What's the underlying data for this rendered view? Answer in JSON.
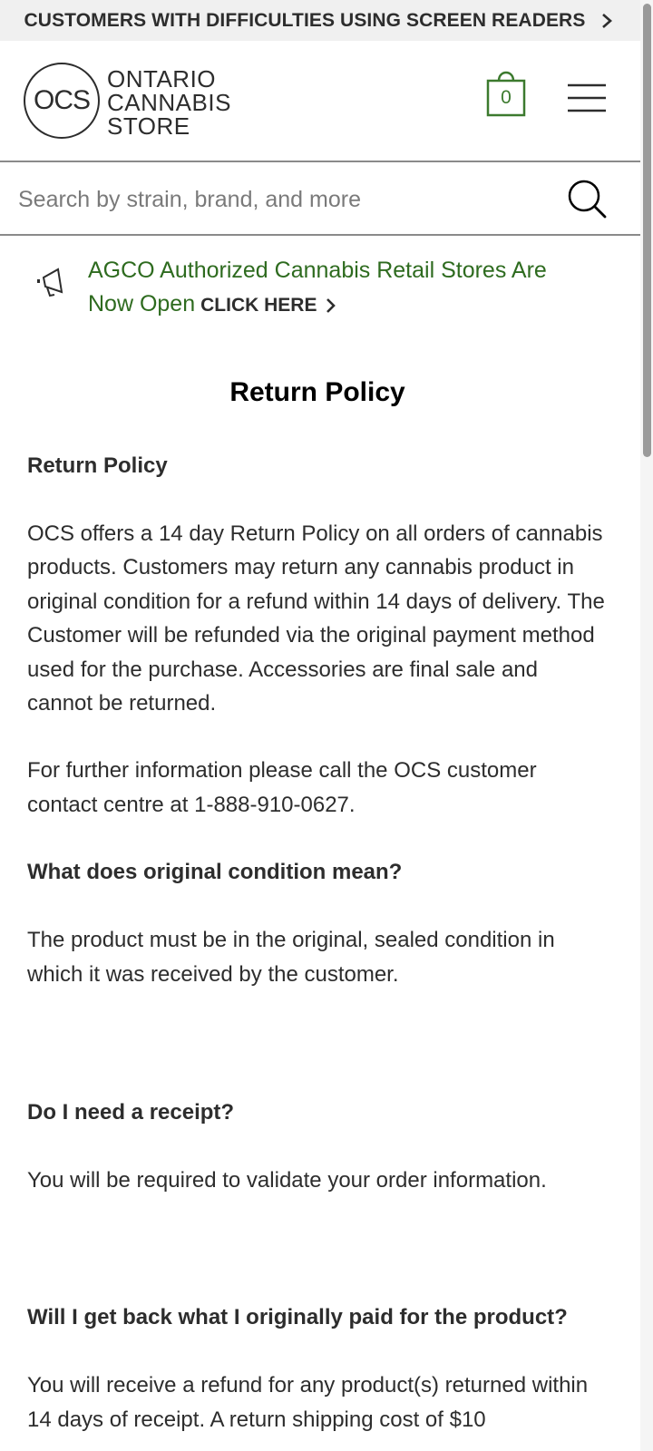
{
  "accessibility_banner": {
    "text": "CUSTOMERS WITH DIFFICULTIES USING SCREEN READERS"
  },
  "header": {
    "logo_abbr": "OCS",
    "logo_line1": "ONTARIO",
    "logo_line2": "CANNABIS",
    "logo_line3": "STORE",
    "cart_count": "0"
  },
  "search": {
    "placeholder": "Search by strain, brand, and more"
  },
  "announcement": {
    "text": "AGCO Authorized Cannabis Retail Stores Are Now Open",
    "link_label": "CLICK HERE"
  },
  "content": {
    "page_title": "Return Policy",
    "section_heading": "Return Policy",
    "para1": "OCS offers a 14 day Return Policy on all orders of cannabis products. Customers may return any cannabis product in original condition for a refund within 14 days of delivery. The Customer will be refunded via the original payment method used for the purchase. Accessories are final sale and cannot be returned.",
    "para2": "For further information please call the OCS customer contact centre at 1-888-910-0627.",
    "q1": "What does original condition mean?",
    "a1": "The product must be in the original, sealed condition in which it was received by the customer.",
    "q2": "Do I need a receipt?",
    "a2": "You will be required to validate your order information.",
    "q3": "Will I get back what I originally paid for the product?",
    "a3": "You will receive a refund for any product(s) returned within 14 days of receipt. A return shipping cost of $10"
  },
  "colors": {
    "brand_green": "#3c7a2e",
    "link_green": "#2e6b1f",
    "text": "#2d2d2d",
    "banner_bg": "#f0f0f0"
  },
  "icons": [
    "chevron-right-icon",
    "shopping-bag-icon",
    "hamburger-menu-icon",
    "search-icon",
    "megaphone-icon"
  ]
}
